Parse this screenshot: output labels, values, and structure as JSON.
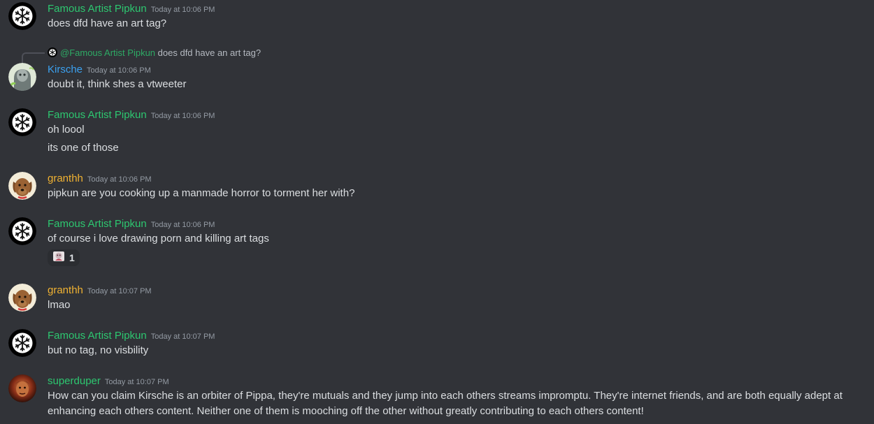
{
  "colors": {
    "background": "#313338",
    "pipkun": "#2dc770",
    "kirsche": "#3ba1f0",
    "granthh": "#f0b232",
    "superduper": "#2dc770",
    "timestamp": "#949ba4",
    "text": "#dbdee1"
  },
  "messages": [
    {
      "author": "Famous Artist Pipkun",
      "time": "Today at 10:06 PM",
      "avatar_icon": "snowflake-icon",
      "lines": [
        "does dfd have an art tag?"
      ]
    },
    {
      "reply": {
        "mention": "@Famous Artist Pipkun",
        "text": "does dfd have an art tag?"
      },
      "author": "Kirsche",
      "time": "Today at 10:06 PM",
      "avatar_icon": "ghost-avatar-icon",
      "lines": [
        "doubt it, think shes a vtweeter"
      ]
    },
    {
      "author": "Famous Artist Pipkun",
      "time": "Today at 10:06 PM",
      "avatar_icon": "snowflake-icon",
      "lines": [
        "oh loool",
        "its one of those"
      ]
    },
    {
      "author": "granthh",
      "time": "Today at 10:06 PM",
      "avatar_icon": "dog-avatar-icon",
      "lines": [
        "pipkun are you cooking up a manmade horror to torment her with?"
      ]
    },
    {
      "author": "Famous Artist Pipkun",
      "time": "Today at 10:06 PM",
      "avatar_icon": "snowflake-icon",
      "lines": [
        "of course i love drawing porn and killing art tags"
      ],
      "reaction": {
        "emoji_icon": "custom-emoji-icon",
        "count": "1"
      }
    },
    {
      "author": "granthh",
      "time": "Today at 10:07 PM",
      "avatar_icon": "dog-avatar-icon",
      "lines": [
        "lmao"
      ]
    },
    {
      "author": "Famous Artist Pipkun",
      "time": "Today at 10:07 PM",
      "avatar_icon": "snowflake-icon",
      "lines": [
        "but no tag, no visbility"
      ]
    },
    {
      "author": "superduper",
      "time": "Today at 10:07 PM",
      "avatar_icon": "photo-avatar-icon",
      "lines": [
        "How can you claim Kirsche is an orbiter of Pippa, they're mutuals and they jump into each others streams impromptu.  They're internet friends, and are both equally adept at enhancing each others content.  Neither one of them is mooching off the other without greatly contributing to each others content!"
      ]
    }
  ]
}
